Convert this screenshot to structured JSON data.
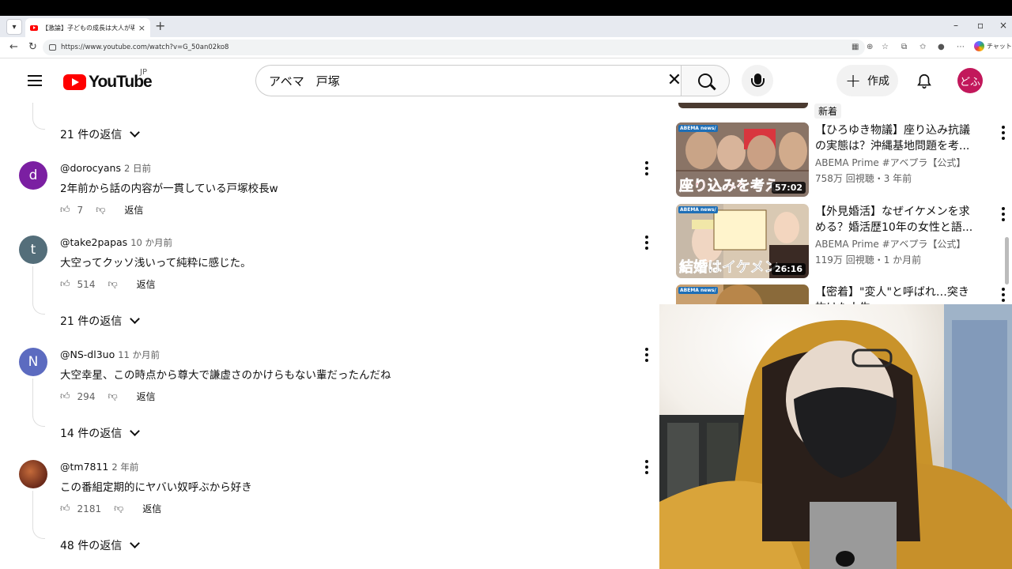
{
  "browser": {
    "tab_title": "【激論】子どもの成長は大人が導く？ ×",
    "tab_title_short": "【激論】子どもの成長は大人が導く？ꗃ",
    "url": "https://www.youtube.com/watch?v=G_50an02ko8",
    "chat_label": "チャット"
  },
  "header": {
    "logo_text": "YouTube",
    "region": "JP",
    "search_query": "アベマ　戸塚",
    "create_label": "作成",
    "avatar_text": "どふ"
  },
  "comments": {
    "reply_toggles": [
      "21 件の返信",
      "21 件の返信",
      "14 件の返信",
      "48 件の返信"
    ],
    "items": [
      {
        "avatar_letter": "d",
        "avatar_color": "#7b1fa2",
        "user": "@dorocyans",
        "time": "2 日前",
        "text": "2年前から話の内容が一貫している戸塚校長w",
        "likes": "7",
        "reply_label": "返信"
      },
      {
        "avatar_letter": "t",
        "avatar_color": "#546e7a",
        "user": "@take2papas",
        "time": "10 か月前",
        "text": "大空ってクッソ浅いって純粋に感じた。",
        "likes": "514",
        "reply_label": "返信"
      },
      {
        "avatar_letter": "N",
        "avatar_color": "#5c6bc0",
        "user": "@NS-dl3uo",
        "time": "11 か月前",
        "text": "大空幸星、この時点から尊大で謙虚さのかけらもない輩だったんだね",
        "likes": "294",
        "reply_label": "返信"
      },
      {
        "avatar_letter": "",
        "avatar_color": "#8d3a2a",
        "user": "@tm7811",
        "time": "2 年前",
        "text": "この番組定期的にヤバい奴呼ぶから好き",
        "likes": "2181",
        "reply_label": "返信"
      }
    ]
  },
  "sidebar": {
    "badge_new": "新着",
    "videos": [
      {
        "title": "【ひろゆき物議】座り込み抗議の実態は？沖縄基地問題を考...",
        "channel": "ABEMA Prime #アベプラ【公式】",
        "meta": "758万 回視聴・3 年前",
        "duration": "57:02",
        "thumb_caption": "座り込みを考え"
      },
      {
        "title": "【外見婚活】なぜイケメンを求める？婚活歴10年の女性と語...",
        "channel": "ABEMA Prime #アベプラ【公式】",
        "meta": "119万 回視聴・1 か月前",
        "duration": "26:16",
        "thumb_caption": "結婚はイケメン"
      },
      {
        "title": "【密着】\"変人\"と呼ばれ…突き抜けた人生…",
        "channel": "",
        "meta": "",
        "duration": "",
        "thumb_caption": ""
      }
    ],
    "thumb_tag": "ABEMA news/"
  },
  "colors": {
    "youtube_red": "#ff0000",
    "text_primary": "#0f0f0f",
    "text_secondary": "#606060",
    "avatar_me": "#c2185b"
  }
}
